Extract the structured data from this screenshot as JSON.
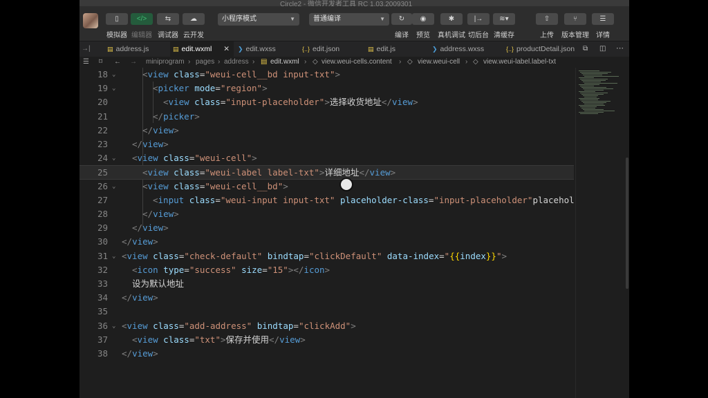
{
  "window": {
    "title": "Circle2 - 微信开发者工具 RC 1.03.2009301"
  },
  "toolbar": {
    "left_buttons": [
      {
        "label": "模拟器",
        "icon": "phone-icon"
      },
      {
        "label": "编辑器",
        "icon": "code-icon"
      },
      {
        "label": "调试器",
        "icon": "debug-icon"
      },
      {
        "label": "云开发",
        "icon": "cloud-icon"
      }
    ],
    "mode_select": "小程序模式",
    "compile_select": "普通编译",
    "right_buttons": [
      {
        "label": "编译",
        "icon": "refresh-icon"
      },
      {
        "label": "预览",
        "icon": "eye-icon"
      },
      {
        "label": "真机调试",
        "icon": "bug-icon"
      },
      {
        "label": "切后台",
        "icon": "switch-icon"
      },
      {
        "label": "清缓存",
        "icon": "layers-icon"
      }
    ],
    "far_right_buttons": [
      {
        "label": "上传",
        "icon": "upload-icon"
      },
      {
        "label": "版本管理",
        "icon": "branch-icon"
      },
      {
        "label": "详情",
        "icon": "menu-icon"
      }
    ]
  },
  "tabs": [
    {
      "label": "address.js",
      "icon": "js-icon"
    },
    {
      "label": "edit.wxml",
      "icon": "wxml-icon",
      "active": true
    },
    {
      "label": "edit.wxss",
      "icon": "css-icon"
    },
    {
      "label": "edit.json",
      "icon": "json-icon"
    },
    {
      "label": "edit.js",
      "icon": "js-icon"
    },
    {
      "label": "address.wxss",
      "icon": "css-icon"
    },
    {
      "label": "productDetail.json",
      "icon": "json-icon"
    }
  ],
  "breadcrumb": [
    "miniprogram",
    "pages",
    "address",
    "edit.wxml",
    "view.weui-cells.content",
    "view.weui-cell",
    "view.weui-label.label-txt"
  ],
  "code_lines": [
    {
      "num": "18",
      "text": "<view class=\"weui-cell__bd input-txt\">"
    },
    {
      "num": "19",
      "text": "<picker mode=\"region\">"
    },
    {
      "num": "20",
      "text": "<view class=\"input-placeholder\">选择收货地址</view>"
    },
    {
      "num": "21",
      "text": "</picker>"
    },
    {
      "num": "22",
      "text": "</view>"
    },
    {
      "num": "23",
      "text": "</view>"
    },
    {
      "num": "24",
      "text": "<view class=\"weui-cell\">"
    },
    {
      "num": "25",
      "text": "<view class=\"weui-label label-txt\">详细地址</view>"
    },
    {
      "num": "26",
      "text": "<view class=\"weui-cell__bd\">"
    },
    {
      "num": "27",
      "text": "<input class=\"weui-input input-txt\" placeholder-class=\"input-placeholder\" placehol"
    },
    {
      "num": "28",
      "text": "</view>"
    },
    {
      "num": "29",
      "text": "</view>"
    },
    {
      "num": "30",
      "text": "</view>"
    },
    {
      "num": "31",
      "text": "<view class=\"check-default\" bindtap=\"clickDefault\" data-index=\"{{index}}\">"
    },
    {
      "num": "32",
      "text": "<icon type=\"success\" size=\"15\"></icon>"
    },
    {
      "num": "33",
      "text": "设为默认地址"
    },
    {
      "num": "34",
      "text": "</view>"
    },
    {
      "num": "35",
      "text": ""
    },
    {
      "num": "36",
      "text": "<view class=\"add-address\"  bindtap=\"clickAdd\">"
    },
    {
      "num": "37",
      "text": "<view class=\"txt\">保存并使用</view>"
    },
    {
      "num": "38",
      "text": "</view>"
    }
  ]
}
